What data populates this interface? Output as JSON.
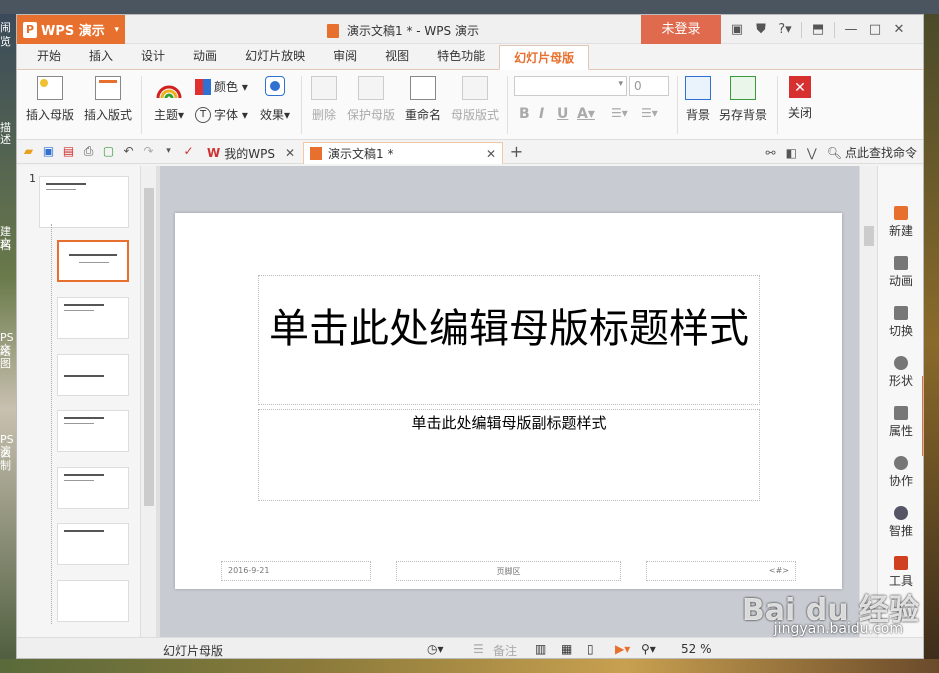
{
  "app": {
    "menu_button": "WPS 演示",
    "doc_title": "演示文稿1 * - WPS 演示",
    "login": "未登录"
  },
  "menu_tabs": [
    "开始",
    "插入",
    "设计",
    "动画",
    "幻灯片放映",
    "审阅",
    "视图",
    "特色功能",
    "幻灯片母版"
  ],
  "ribbon": {
    "insert_master": "插入母版",
    "insert_layout": "插入版式",
    "theme": "主题",
    "color": "颜色",
    "font": "字体",
    "effect": "效果",
    "delete": "删除",
    "protect_master": "保护母版",
    "rename": "重命名",
    "master_layout": "母版版式",
    "font_size_value": "0",
    "background": "背景",
    "save_background": "另存背景",
    "close": "关闭"
  },
  "doc_tabs": {
    "tab1": "我的WPS",
    "tab2": "演示文稿1 *",
    "search_cmd": "点此查找命令"
  },
  "thumbnails": {
    "slide_number": "1"
  },
  "slide": {
    "title": "单击此处编辑母版标题样式",
    "subtitle": "单击此处编辑母版副标题样式",
    "footer_date": "2016-9-21",
    "footer_center": "页脚区",
    "footer_number": "<#>"
  },
  "side_panel": [
    "新建",
    "动画",
    "切换",
    "形状",
    "属性",
    "协作",
    "智推",
    "工具"
  ],
  "status": {
    "view_name": "幻灯片母版",
    "notes": "备注",
    "zoom": "52 %"
  },
  "watermark": {
    "brand": "Bai du 经验",
    "url": "jingyan.baidu.com"
  },
  "desktop_left_fragments": [
    "闹",
    "览",
    "描述",
    "建文",
    "档",
    "PS文",
    "绘图",
    "PS演",
    "么制"
  ]
}
